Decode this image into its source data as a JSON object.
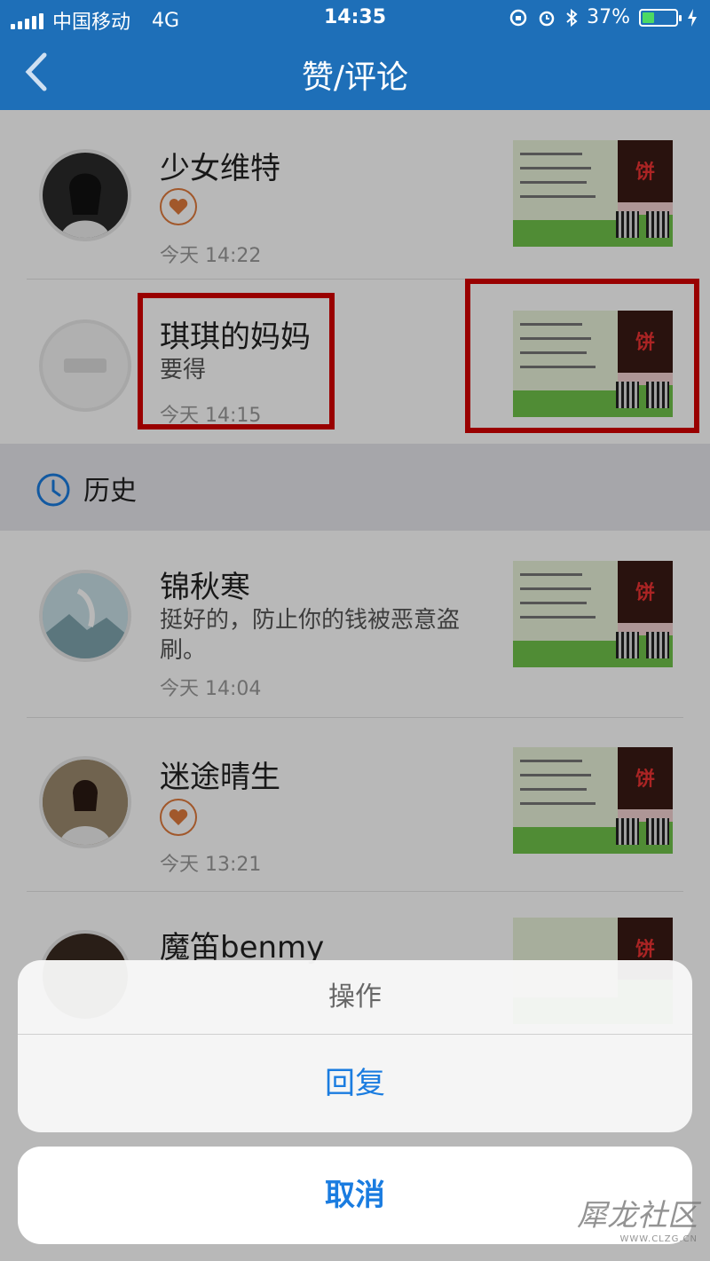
{
  "status_bar": {
    "carrier": "中国移动",
    "network": "4G",
    "time": "14:35",
    "battery": "37%",
    "battery_level": 0.37
  },
  "nav": {
    "title": "赞/评论",
    "back_icon": "chevron-left-icon"
  },
  "items": [
    {
      "name": "少女维特",
      "type": "like",
      "time": "今天 14:22"
    },
    {
      "name": "琪琪的妈妈",
      "comment": "要得",
      "time": "今天 14:15"
    }
  ],
  "history": {
    "label": "历史",
    "icon": "clock-icon",
    "items": [
      {
        "name": "锦秋寒",
        "comment": "挺好的，防止你的钱被恶意盗刷。",
        "time": "今天 14:04"
      },
      {
        "name": "迷途晴生",
        "type": "like",
        "time": "今天 13:21"
      },
      {
        "name": "魔笛benmy"
      }
    ]
  },
  "thumb_sign": "饼",
  "action_sheet": {
    "title": "操作",
    "reply": "回复",
    "cancel": "取消"
  },
  "watermark": {
    "main": "犀龙社区",
    "url": "WWW.CLZG.CN"
  },
  "colors": {
    "nav_bg": "#1e6fb8",
    "accent": "#1a7ce0",
    "heart": "#e07a3c",
    "highlight": "#d40000"
  }
}
